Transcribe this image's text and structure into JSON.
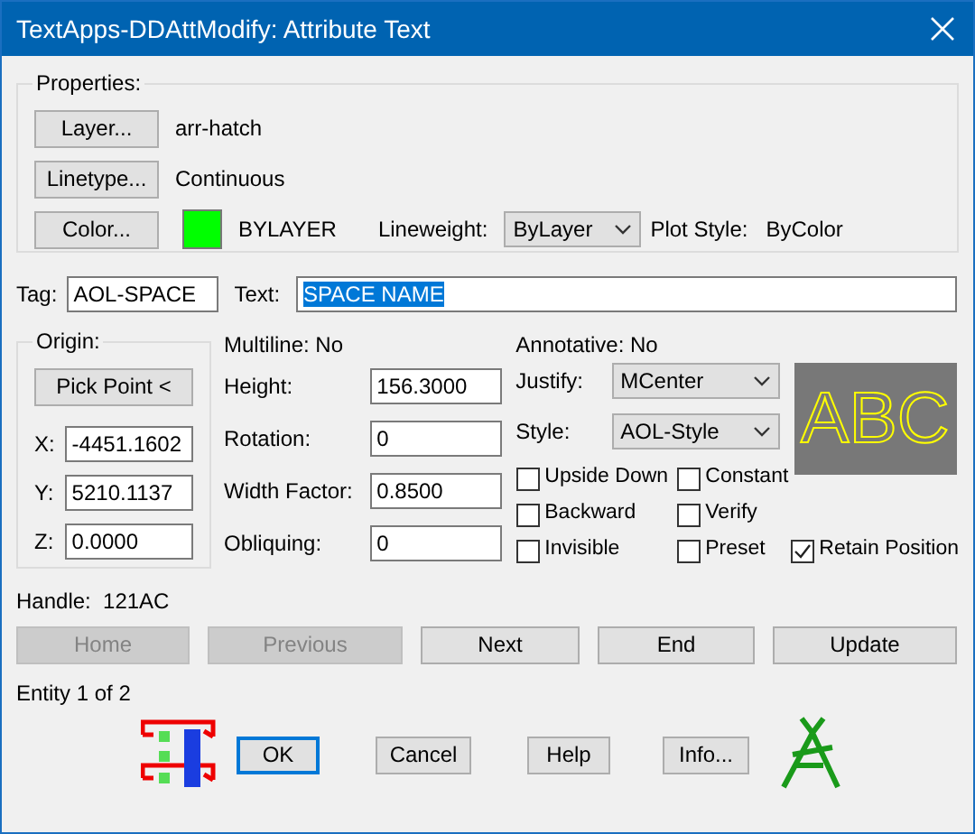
{
  "window": {
    "title": "TextApps-DDAttModify: Attribute Text"
  },
  "properties": {
    "label": "Properties:",
    "rows": [
      {
        "button": "Layer...",
        "value": "arr-hatch"
      },
      {
        "button": "Linetype...",
        "value": "Continuous"
      },
      {
        "button": "Color...",
        "color": "#00ff00",
        "value": "BYLAYER"
      }
    ],
    "lineweight": {
      "label": "Lineweight:",
      "value": "ByLayer"
    },
    "plot_style": {
      "label": "Plot Style:",
      "value": "ByColor"
    }
  },
  "tag": {
    "label": "Tag:",
    "value": "AOL-SPACE"
  },
  "text": {
    "label": "Text:",
    "value": "SPACE NAME",
    "selected": true
  },
  "origin": {
    "label": "Origin:",
    "button": "Pick Point <",
    "coords": [
      {
        "label": "X:",
        "value": "-4451.1602"
      },
      {
        "label": "Y:",
        "value": "5210.1137"
      },
      {
        "label": "Z:",
        "value": "0.0000"
      }
    ]
  },
  "multiline": "Multiline: No",
  "fields": [
    {
      "label": "Height:",
      "value": "156.3000"
    },
    {
      "label": "Rotation:",
      "value": "0"
    },
    {
      "label": "Width Factor:",
      "value": "0.8500"
    },
    {
      "label": "Obliquing:",
      "value": "0"
    }
  ],
  "annotative": "Annotative: No",
  "dropdowns": [
    {
      "label": "Justify:",
      "value": "MCenter"
    },
    {
      "label": "Style:",
      "value": "AOL-Style"
    }
  ],
  "preview": "ABC",
  "checkboxes": [
    {
      "label": "Upside Down",
      "checked": false
    },
    {
      "label": "Constant",
      "checked": false
    },
    {
      "label": "Backward",
      "checked": false
    },
    {
      "label": "Verify",
      "checked": false
    },
    {
      "label": "Invisible",
      "checked": false
    },
    {
      "label": "Preset",
      "checked": false
    },
    {
      "label": "Retain Position",
      "checked": true
    }
  ],
  "handle": "Handle:  121AC",
  "nav_buttons": [
    {
      "label": "Home",
      "disabled": true
    },
    {
      "label": "Previous",
      "disabled": true
    },
    {
      "label": "Next",
      "disabled": false
    },
    {
      "label": "End",
      "disabled": false
    },
    {
      "label": "Update",
      "disabled": false
    }
  ],
  "entity": "Entity 1 of 2",
  "buttons": [
    {
      "label": "OK",
      "default": true
    },
    {
      "label": "Cancel",
      "default": false
    },
    {
      "label": "Help",
      "default": false
    },
    {
      "label": "Info...",
      "default": false
    }
  ]
}
